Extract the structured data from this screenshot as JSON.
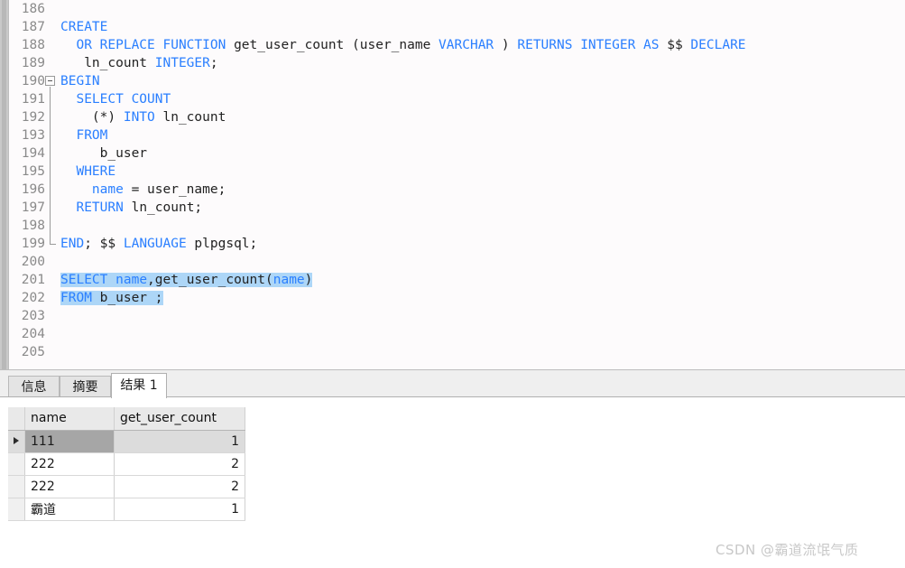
{
  "editor": {
    "first_visible_line": 186,
    "lines": [
      {
        "number": "186",
        "indent": 0,
        "tokens": []
      },
      {
        "number": "187",
        "indent": 0,
        "tokens": [
          {
            "t": "CREATE",
            "c": "kw"
          }
        ]
      },
      {
        "number": "188",
        "indent": 0,
        "tokens": [
          {
            "t": "  ",
            "c": "pl"
          },
          {
            "t": "OR REPLACE FUNCTION",
            "c": "kw"
          },
          {
            "t": " get_user_count (user_name ",
            "c": "pl"
          },
          {
            "t": "VARCHAR",
            "c": "kw"
          },
          {
            "t": " ) ",
            "c": "pl"
          },
          {
            "t": "RETURNS INTEGER AS",
            "c": "kw"
          },
          {
            "t": " $$ ",
            "c": "pl"
          },
          {
            "t": "DECLARE",
            "c": "kw"
          }
        ]
      },
      {
        "number": "189",
        "indent": 0,
        "tokens": [
          {
            "t": "   ln_count ",
            "c": "pl"
          },
          {
            "t": "INTEGER",
            "c": "kw"
          },
          {
            "t": ";",
            "c": "pl"
          }
        ]
      },
      {
        "number": "190",
        "indent": 0,
        "tokens": [
          {
            "t": "BEGIN",
            "c": "kw"
          }
        ]
      },
      {
        "number": "191",
        "indent": 0,
        "tokens": [
          {
            "t": "  ",
            "c": "pl"
          },
          {
            "t": "SELECT COUNT",
            "c": "kw"
          }
        ]
      },
      {
        "number": "192",
        "indent": 0,
        "tokens": [
          {
            "t": "    (*) ",
            "c": "pl"
          },
          {
            "t": "INTO",
            "c": "kw"
          },
          {
            "t": " ln_count",
            "c": "pl"
          }
        ]
      },
      {
        "number": "193",
        "indent": 0,
        "tokens": [
          {
            "t": "  ",
            "c": "pl"
          },
          {
            "t": "FROM",
            "c": "kw"
          }
        ]
      },
      {
        "number": "194",
        "indent": 0,
        "tokens": [
          {
            "t": "     b_user",
            "c": "pl"
          }
        ]
      },
      {
        "number": "195",
        "indent": 0,
        "tokens": [
          {
            "t": "  ",
            "c": "pl"
          },
          {
            "t": "WHERE",
            "c": "kw"
          }
        ]
      },
      {
        "number": "196",
        "indent": 0,
        "tokens": [
          {
            "t": "    ",
            "c": "pl"
          },
          {
            "t": "name",
            "c": "kw"
          },
          {
            "t": " = user_name;",
            "c": "pl"
          }
        ]
      },
      {
        "number": "197",
        "indent": 0,
        "tokens": [
          {
            "t": "  ",
            "c": "pl"
          },
          {
            "t": "RETURN",
            "c": "kw"
          },
          {
            "t": " ln_count;",
            "c": "pl"
          }
        ]
      },
      {
        "number": "198",
        "indent": 0,
        "tokens": []
      },
      {
        "number": "199",
        "indent": 0,
        "tokens": [
          {
            "t": "END",
            "c": "kw"
          },
          {
            "t": "; $$ ",
            "c": "pl"
          },
          {
            "t": "LANGUAGE",
            "c": "kw"
          },
          {
            "t": " plpgsql;",
            "c": "pl"
          }
        ]
      },
      {
        "number": "200",
        "indent": 0,
        "tokens": []
      },
      {
        "number": "201",
        "indent": 0,
        "selected": true,
        "tokens": [
          {
            "t": "SELECT",
            "c": "kw"
          },
          {
            "t": " ",
            "c": "pl"
          },
          {
            "t": "name",
            "c": "kw"
          },
          {
            "t": ",get_user_count(",
            "c": "pl"
          },
          {
            "t": "name",
            "c": "kw"
          },
          {
            "t": ")",
            "c": "pl"
          }
        ]
      },
      {
        "number": "202",
        "indent": 0,
        "selected": true,
        "tokens": [
          {
            "t": "FROM",
            "c": "kw"
          },
          {
            "t": " b_user ;",
            "c": "pl"
          }
        ]
      },
      {
        "number": "203",
        "indent": 0,
        "tokens": []
      },
      {
        "number": "204",
        "indent": 0,
        "tokens": []
      },
      {
        "number": "205",
        "indent": 0,
        "tokens": []
      }
    ],
    "fold": {
      "start_line": "190",
      "end_line": "199",
      "marker": "collapse"
    }
  },
  "results_panel": {
    "tabs": [
      {
        "id": "info",
        "label": "信息",
        "active": false
      },
      {
        "id": "sum",
        "label": "摘要",
        "active": false
      },
      {
        "id": "result",
        "label": "结果 1",
        "active": true
      }
    ],
    "grid": {
      "columns": [
        "name",
        "get_user_count"
      ],
      "rows": [
        {
          "name": "111",
          "get_user_count": "1",
          "selected": true
        },
        {
          "name": "222",
          "get_user_count": "2",
          "selected": false
        },
        {
          "name": "222",
          "get_user_count": "2",
          "selected": false
        },
        {
          "name": "霸道",
          "get_user_count": "1",
          "selected": false
        }
      ]
    }
  },
  "watermark": {
    "text": "CSDN @霸道流氓气质"
  },
  "colors": {
    "keyword": "#2a7fff",
    "plain": "#222222",
    "selection": "#add6f7",
    "gutter_number": "#8a8a8a",
    "row_selected": "#a6a6a6"
  }
}
